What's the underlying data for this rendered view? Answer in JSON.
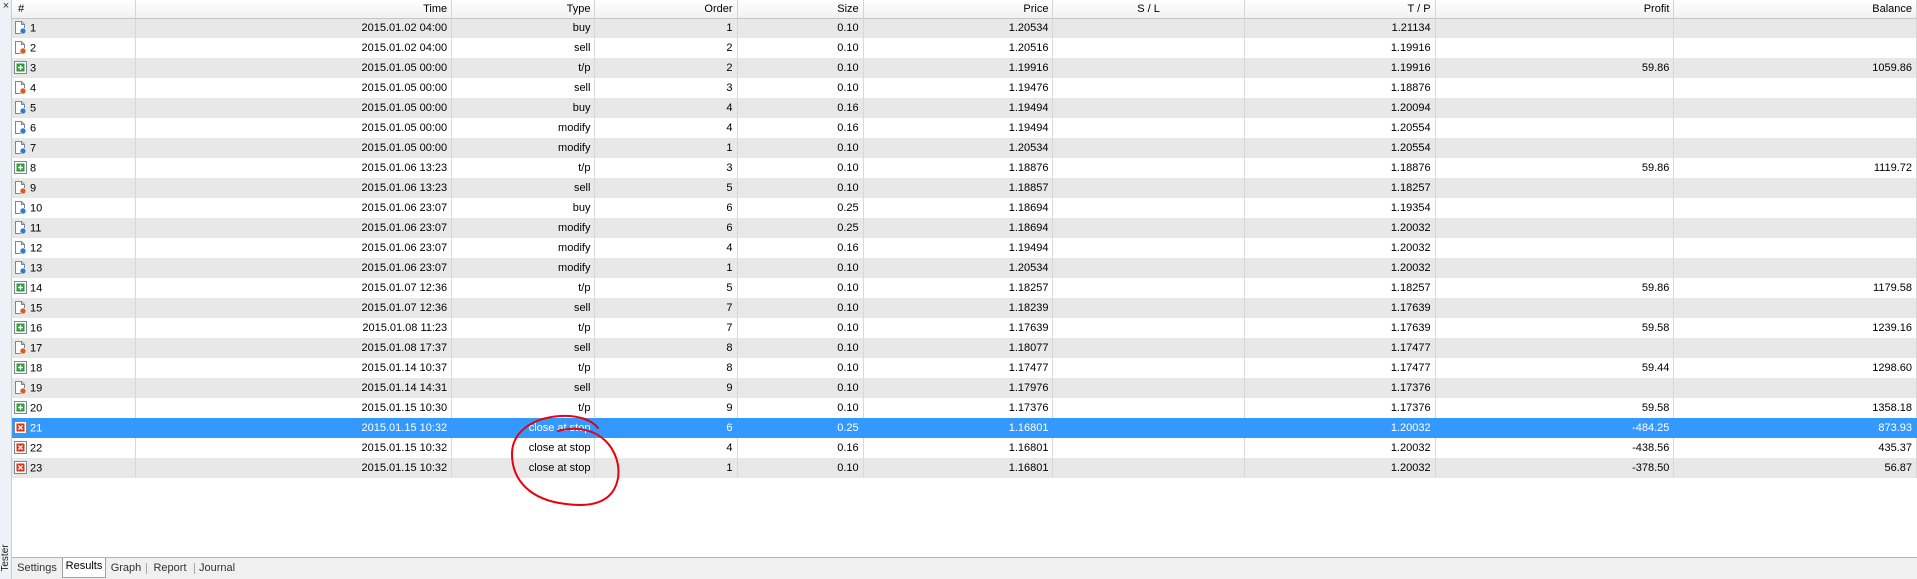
{
  "side_panel": {
    "title": "Tester",
    "close_symbol": "×"
  },
  "columns": [
    "#",
    "Time",
    "Type",
    "Order",
    "Size",
    "Price",
    "S / L",
    "T / P",
    "Profit",
    "Balance"
  ],
  "rows": [
    {
      "num": "1",
      "time": "2015.01.02 04:00",
      "type": "buy",
      "order": "1",
      "size": "0.10",
      "price": "1.20534",
      "sl": "",
      "tp": "1.21134",
      "profit": "",
      "balance": "",
      "icon": "buy-order-icon"
    },
    {
      "num": "2",
      "time": "2015.01.02 04:00",
      "type": "sell",
      "order": "2",
      "size": "0.10",
      "price": "1.20516",
      "sl": "",
      "tp": "1.19916",
      "profit": "",
      "balance": "",
      "icon": "sell-order-icon"
    },
    {
      "num": "3",
      "time": "2015.01.05 00:00",
      "type": "t/p",
      "order": "2",
      "size": "0.10",
      "price": "1.19916",
      "sl": "",
      "tp": "1.19916",
      "profit": "59.86",
      "balance": "1059.86",
      "icon": "take-profit-icon"
    },
    {
      "num": "4",
      "time": "2015.01.05 00:00",
      "type": "sell",
      "order": "3",
      "size": "0.10",
      "price": "1.19476",
      "sl": "",
      "tp": "1.18876",
      "profit": "",
      "balance": "",
      "icon": "sell-order-icon"
    },
    {
      "num": "5",
      "time": "2015.01.05 00:00",
      "type": "buy",
      "order": "4",
      "size": "0.16",
      "price": "1.19494",
      "sl": "",
      "tp": "1.20094",
      "profit": "",
      "balance": "",
      "icon": "buy-order-icon"
    },
    {
      "num": "6",
      "time": "2015.01.05 00:00",
      "type": "modify",
      "order": "4",
      "size": "0.16",
      "price": "1.19494",
      "sl": "",
      "tp": "1.20554",
      "profit": "",
      "balance": "",
      "icon": "modify-order-icon"
    },
    {
      "num": "7",
      "time": "2015.01.05 00:00",
      "type": "modify",
      "order": "1",
      "size": "0.10",
      "price": "1.20534",
      "sl": "",
      "tp": "1.20554",
      "profit": "",
      "balance": "",
      "icon": "modify-order-icon"
    },
    {
      "num": "8",
      "time": "2015.01.06 13:23",
      "type": "t/p",
      "order": "3",
      "size": "0.10",
      "price": "1.18876",
      "sl": "",
      "tp": "1.18876",
      "profit": "59.86",
      "balance": "1119.72",
      "icon": "take-profit-icon"
    },
    {
      "num": "9",
      "time": "2015.01.06 13:23",
      "type": "sell",
      "order": "5",
      "size": "0.10",
      "price": "1.18857",
      "sl": "",
      "tp": "1.18257",
      "profit": "",
      "balance": "",
      "icon": "sell-order-icon"
    },
    {
      "num": "10",
      "time": "2015.01.06 23:07",
      "type": "buy",
      "order": "6",
      "size": "0.25",
      "price": "1.18694",
      "sl": "",
      "tp": "1.19354",
      "profit": "",
      "balance": "",
      "icon": "buy-order-icon"
    },
    {
      "num": "11",
      "time": "2015.01.06 23:07",
      "type": "modify",
      "order": "6",
      "size": "0.25",
      "price": "1.18694",
      "sl": "",
      "tp": "1.20032",
      "profit": "",
      "balance": "",
      "icon": "modify-order-icon"
    },
    {
      "num": "12",
      "time": "2015.01.06 23:07",
      "type": "modify",
      "order": "4",
      "size": "0.16",
      "price": "1.19494",
      "sl": "",
      "tp": "1.20032",
      "profit": "",
      "balance": "",
      "icon": "modify-order-icon"
    },
    {
      "num": "13",
      "time": "2015.01.06 23:07",
      "type": "modify",
      "order": "1",
      "size": "0.10",
      "price": "1.20534",
      "sl": "",
      "tp": "1.20032",
      "profit": "",
      "balance": "",
      "icon": "modify-order-icon"
    },
    {
      "num": "14",
      "time": "2015.01.07 12:36",
      "type": "t/p",
      "order": "5",
      "size": "0.10",
      "price": "1.18257",
      "sl": "",
      "tp": "1.18257",
      "profit": "59.86",
      "balance": "1179.58",
      "icon": "take-profit-icon"
    },
    {
      "num": "15",
      "time": "2015.01.07 12:36",
      "type": "sell",
      "order": "7",
      "size": "0.10",
      "price": "1.18239",
      "sl": "",
      "tp": "1.17639",
      "profit": "",
      "balance": "",
      "icon": "sell-order-icon"
    },
    {
      "num": "16",
      "time": "2015.01.08 11:23",
      "type": "t/p",
      "order": "7",
      "size": "0.10",
      "price": "1.17639",
      "sl": "",
      "tp": "1.17639",
      "profit": "59.58",
      "balance": "1239.16",
      "icon": "take-profit-icon"
    },
    {
      "num": "17",
      "time": "2015.01.08 17:37",
      "type": "sell",
      "order": "8",
      "size": "0.10",
      "price": "1.18077",
      "sl": "",
      "tp": "1.17477",
      "profit": "",
      "balance": "",
      "icon": "sell-order-icon"
    },
    {
      "num": "18",
      "time": "2015.01.14 10:37",
      "type": "t/p",
      "order": "8",
      "size": "0.10",
      "price": "1.17477",
      "sl": "",
      "tp": "1.17477",
      "profit": "59.44",
      "balance": "1298.60",
      "icon": "take-profit-icon"
    },
    {
      "num": "19",
      "time": "2015.01.14 14:31",
      "type": "sell",
      "order": "9",
      "size": "0.10",
      "price": "1.17976",
      "sl": "",
      "tp": "1.17376",
      "profit": "",
      "balance": "",
      "icon": "sell-order-icon"
    },
    {
      "num": "20",
      "time": "2015.01.15 10:30",
      "type": "t/p",
      "order": "9",
      "size": "0.10",
      "price": "1.17376",
      "sl": "",
      "tp": "1.17376",
      "profit": "59.58",
      "balance": "1358.18",
      "icon": "take-profit-icon"
    },
    {
      "num": "21",
      "time": "2015.01.15 10:32",
      "type": "close at stop",
      "order": "6",
      "size": "0.25",
      "price": "1.16801",
      "sl": "",
      "tp": "1.20032",
      "profit": "-484.25",
      "balance": "873.93",
      "icon": "close-at-stop-icon",
      "selected": true
    },
    {
      "num": "22",
      "time": "2015.01.15 10:32",
      "type": "close at stop",
      "order": "4",
      "size": "0.16",
      "price": "1.16801",
      "sl": "",
      "tp": "1.20032",
      "profit": "-438.56",
      "balance": "435.37",
      "icon": "close-at-stop-icon"
    },
    {
      "num": "23",
      "time": "2015.01.15 10:32",
      "type": "close at stop",
      "order": "1",
      "size": "0.10",
      "price": "1.16801",
      "sl": "",
      "tp": "1.20032",
      "profit": "-378.50",
      "balance": "56.87",
      "icon": "close-at-stop-icon"
    }
  ],
  "tabs": [
    {
      "label": "Settings",
      "active": false
    },
    {
      "label": "Results",
      "active": true
    },
    {
      "label": "Graph",
      "active": false
    },
    {
      "label": "Report",
      "active": false
    },
    {
      "label": "Journal",
      "active": false
    }
  ],
  "colors": {
    "selection": "#3399ff",
    "annotation": "#e8000b",
    "buy_dot": "#2a7fd4",
    "sell_dot": "#e05a1c",
    "tp_green": "#2e9b3a",
    "stop_red": "#d9381e"
  }
}
